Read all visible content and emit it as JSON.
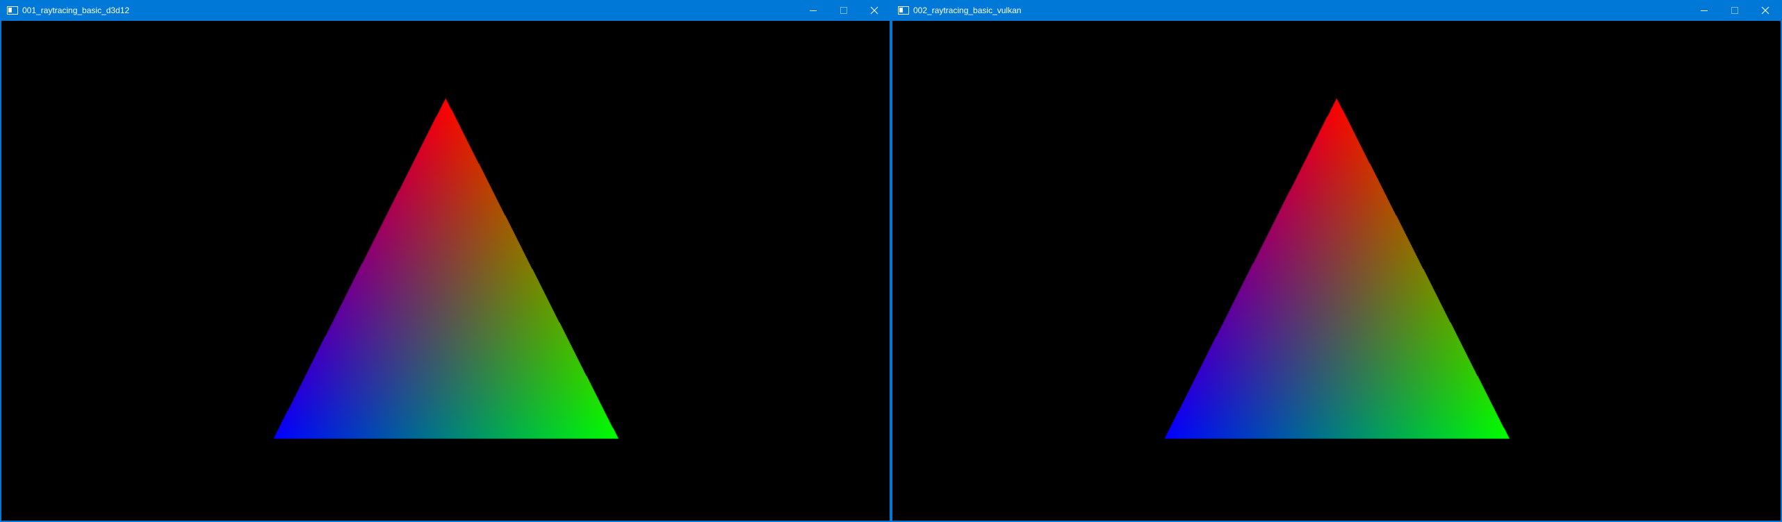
{
  "windows": [
    {
      "title": "001_raytracing_basic_d3d12",
      "icon": "console-app-icon",
      "controls": [
        "minimize-icon",
        "maximize-icon",
        "close-icon"
      ],
      "scene": {
        "background": "#000000",
        "vertex_colors": {
          "top": "#ff0000",
          "bottom_right": "#00ff00",
          "bottom_left": "#0000ff"
        }
      }
    },
    {
      "title": "002_raytracing_basic_vulkan",
      "icon": "console-app-icon",
      "controls": [
        "minimize-icon",
        "maximize-icon",
        "close-icon"
      ],
      "scene": {
        "background": "#000000",
        "vertex_colors": {
          "top": "#ff0000",
          "bottom_right": "#00ff00",
          "bottom_left": "#0000ff"
        }
      }
    }
  ],
  "colors": {
    "titlebar": "#0078d7",
    "title_text": "#ffffff"
  }
}
